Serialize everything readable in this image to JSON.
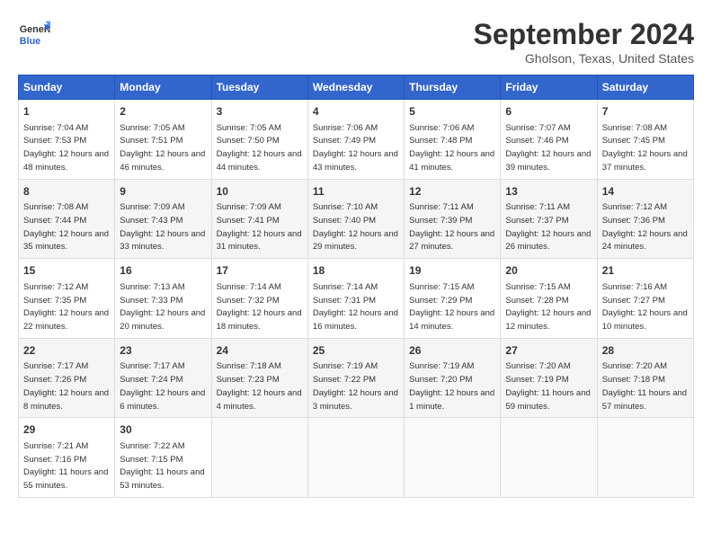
{
  "header": {
    "logo_line1": "General",
    "logo_line2": "Blue",
    "month_title": "September 2024",
    "location": "Gholson, Texas, United States"
  },
  "columns": [
    "Sunday",
    "Monday",
    "Tuesday",
    "Wednesday",
    "Thursday",
    "Friday",
    "Saturday"
  ],
  "weeks": [
    [
      {
        "day": "1",
        "sunrise": "Sunrise: 7:04 AM",
        "sunset": "Sunset: 7:53 PM",
        "daylight": "Daylight: 12 hours and 48 minutes."
      },
      {
        "day": "2",
        "sunrise": "Sunrise: 7:05 AM",
        "sunset": "Sunset: 7:51 PM",
        "daylight": "Daylight: 12 hours and 46 minutes."
      },
      {
        "day": "3",
        "sunrise": "Sunrise: 7:05 AM",
        "sunset": "Sunset: 7:50 PM",
        "daylight": "Daylight: 12 hours and 44 minutes."
      },
      {
        "day": "4",
        "sunrise": "Sunrise: 7:06 AM",
        "sunset": "Sunset: 7:49 PM",
        "daylight": "Daylight: 12 hours and 43 minutes."
      },
      {
        "day": "5",
        "sunrise": "Sunrise: 7:06 AM",
        "sunset": "Sunset: 7:48 PM",
        "daylight": "Daylight: 12 hours and 41 minutes."
      },
      {
        "day": "6",
        "sunrise": "Sunrise: 7:07 AM",
        "sunset": "Sunset: 7:46 PM",
        "daylight": "Daylight: 12 hours and 39 minutes."
      },
      {
        "day": "7",
        "sunrise": "Sunrise: 7:08 AM",
        "sunset": "Sunset: 7:45 PM",
        "daylight": "Daylight: 12 hours and 37 minutes."
      }
    ],
    [
      {
        "day": "8",
        "sunrise": "Sunrise: 7:08 AM",
        "sunset": "Sunset: 7:44 PM",
        "daylight": "Daylight: 12 hours and 35 minutes."
      },
      {
        "day": "9",
        "sunrise": "Sunrise: 7:09 AM",
        "sunset": "Sunset: 7:43 PM",
        "daylight": "Daylight: 12 hours and 33 minutes."
      },
      {
        "day": "10",
        "sunrise": "Sunrise: 7:09 AM",
        "sunset": "Sunset: 7:41 PM",
        "daylight": "Daylight: 12 hours and 31 minutes."
      },
      {
        "day": "11",
        "sunrise": "Sunrise: 7:10 AM",
        "sunset": "Sunset: 7:40 PM",
        "daylight": "Daylight: 12 hours and 29 minutes."
      },
      {
        "day": "12",
        "sunrise": "Sunrise: 7:11 AM",
        "sunset": "Sunset: 7:39 PM",
        "daylight": "Daylight: 12 hours and 27 minutes."
      },
      {
        "day": "13",
        "sunrise": "Sunrise: 7:11 AM",
        "sunset": "Sunset: 7:37 PM",
        "daylight": "Daylight: 12 hours and 26 minutes."
      },
      {
        "day": "14",
        "sunrise": "Sunrise: 7:12 AM",
        "sunset": "Sunset: 7:36 PM",
        "daylight": "Daylight: 12 hours and 24 minutes."
      }
    ],
    [
      {
        "day": "15",
        "sunrise": "Sunrise: 7:12 AM",
        "sunset": "Sunset: 7:35 PM",
        "daylight": "Daylight: 12 hours and 22 minutes."
      },
      {
        "day": "16",
        "sunrise": "Sunrise: 7:13 AM",
        "sunset": "Sunset: 7:33 PM",
        "daylight": "Daylight: 12 hours and 20 minutes."
      },
      {
        "day": "17",
        "sunrise": "Sunrise: 7:14 AM",
        "sunset": "Sunset: 7:32 PM",
        "daylight": "Daylight: 12 hours and 18 minutes."
      },
      {
        "day": "18",
        "sunrise": "Sunrise: 7:14 AM",
        "sunset": "Sunset: 7:31 PM",
        "daylight": "Daylight: 12 hours and 16 minutes."
      },
      {
        "day": "19",
        "sunrise": "Sunrise: 7:15 AM",
        "sunset": "Sunset: 7:29 PM",
        "daylight": "Daylight: 12 hours and 14 minutes."
      },
      {
        "day": "20",
        "sunrise": "Sunrise: 7:15 AM",
        "sunset": "Sunset: 7:28 PM",
        "daylight": "Daylight: 12 hours and 12 minutes."
      },
      {
        "day": "21",
        "sunrise": "Sunrise: 7:16 AM",
        "sunset": "Sunset: 7:27 PM",
        "daylight": "Daylight: 12 hours and 10 minutes."
      }
    ],
    [
      {
        "day": "22",
        "sunrise": "Sunrise: 7:17 AM",
        "sunset": "Sunset: 7:26 PM",
        "daylight": "Daylight: 12 hours and 8 minutes."
      },
      {
        "day": "23",
        "sunrise": "Sunrise: 7:17 AM",
        "sunset": "Sunset: 7:24 PM",
        "daylight": "Daylight: 12 hours and 6 minutes."
      },
      {
        "day": "24",
        "sunrise": "Sunrise: 7:18 AM",
        "sunset": "Sunset: 7:23 PM",
        "daylight": "Daylight: 12 hours and 4 minutes."
      },
      {
        "day": "25",
        "sunrise": "Sunrise: 7:19 AM",
        "sunset": "Sunset: 7:22 PM",
        "daylight": "Daylight: 12 hours and 3 minutes."
      },
      {
        "day": "26",
        "sunrise": "Sunrise: 7:19 AM",
        "sunset": "Sunset: 7:20 PM",
        "daylight": "Daylight: 12 hours and 1 minute."
      },
      {
        "day": "27",
        "sunrise": "Sunrise: 7:20 AM",
        "sunset": "Sunset: 7:19 PM",
        "daylight": "Daylight: 11 hours and 59 minutes."
      },
      {
        "day": "28",
        "sunrise": "Sunrise: 7:20 AM",
        "sunset": "Sunset: 7:18 PM",
        "daylight": "Daylight: 11 hours and 57 minutes."
      }
    ],
    [
      {
        "day": "29",
        "sunrise": "Sunrise: 7:21 AM",
        "sunset": "Sunset: 7:16 PM",
        "daylight": "Daylight: 11 hours and 55 minutes."
      },
      {
        "day": "30",
        "sunrise": "Sunrise: 7:22 AM",
        "sunset": "Sunset: 7:15 PM",
        "daylight": "Daylight: 11 hours and 53 minutes."
      },
      null,
      null,
      null,
      null,
      null
    ]
  ]
}
